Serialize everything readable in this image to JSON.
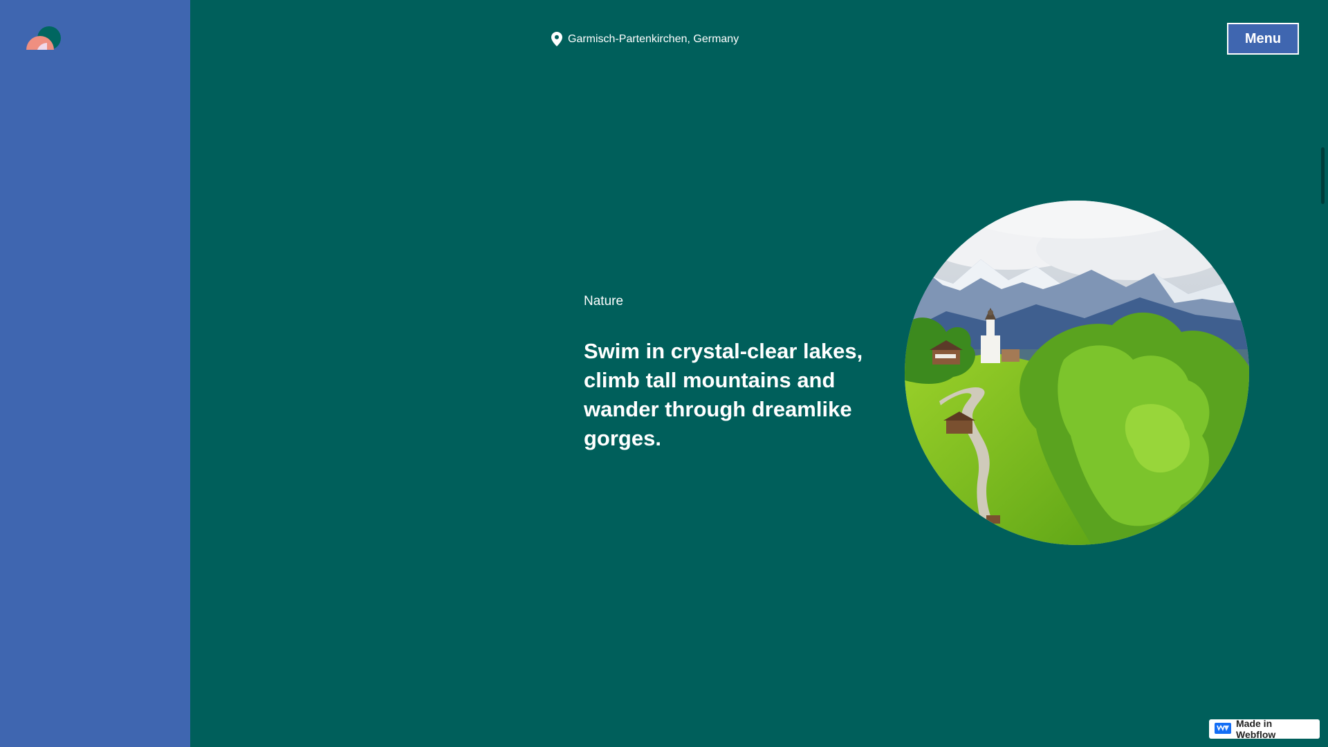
{
  "header": {
    "location_text": "Garmisch-Partenkirchen, Germany",
    "menu_label": "Menu"
  },
  "hero": {
    "eyebrow": "Nature",
    "headline": "Swim in crystal-clear lakes, climb tall mountains and wander through dreamlike gorges."
  },
  "badge": {
    "label": "Made in Webflow"
  },
  "icons": {
    "logo": "brand-logo",
    "location": "location-pin-icon",
    "webflow": "webflow-logo-icon"
  },
  "colors": {
    "sidebar": "#3f66b0",
    "background": "#005f5b",
    "text": "#ffffff",
    "logo_dark": "#006660",
    "logo_peach": "#ef8f80",
    "logo_light": "#f0d9ea",
    "webflow_blue": "#146ef5"
  }
}
